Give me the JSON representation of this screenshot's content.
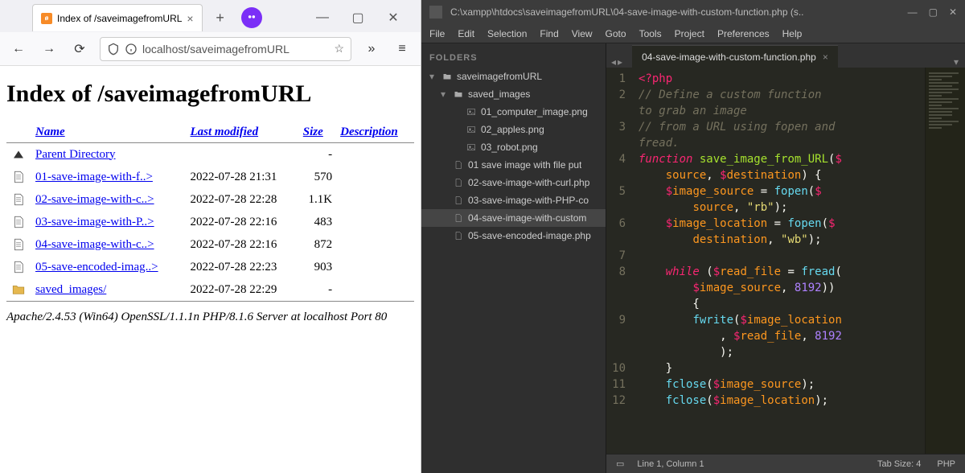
{
  "browser": {
    "tab_title": "Index of /saveimagefromURL",
    "url": "localhost/saveimagefromURL",
    "window_buttons": {
      "min": "—",
      "max": "▢",
      "close": "✕"
    }
  },
  "dirindex": {
    "heading": "Index of /saveimagefromURL",
    "columns": {
      "name": "Name",
      "modified": "Last modified",
      "size": "Size",
      "desc": "Description"
    },
    "parent": "Parent Directory",
    "rows": [
      {
        "name": "01-save-image-with-f..>",
        "modified": "2022-07-28 21:31",
        "size": "570"
      },
      {
        "name": "02-save-image-with-c..>",
        "modified": "2022-07-28 22:28",
        "size": "1.1K"
      },
      {
        "name": "03-save-image-with-P..>",
        "modified": "2022-07-28 22:16",
        "size": "483"
      },
      {
        "name": "04-save-image-with-c..>",
        "modified": "2022-07-28 22:16",
        "size": "872"
      },
      {
        "name": "05-save-encoded-imag..>",
        "modified": "2022-07-28 22:23",
        "size": "903"
      },
      {
        "name": "saved_images/",
        "modified": "2022-07-28 22:29",
        "size": "-"
      }
    ],
    "footer": "Apache/2.4.53 (Win64) OpenSSL/1.1.1n PHP/8.1.6 Server at localhost Port 80"
  },
  "sublime": {
    "title": "C:\\xampp\\htdocs\\saveimagefromURL\\04-save-image-with-custom-function.php (s..",
    "menu": [
      "File",
      "Edit",
      "Selection",
      "Find",
      "View",
      "Goto",
      "Tools",
      "Project",
      "Preferences",
      "Help"
    ],
    "sidebar_title": "FOLDERS",
    "tree": {
      "root": "saveimagefromURL",
      "folder": "saved_images",
      "images": [
        "01_computer_image.png",
        "02_apples.png",
        "03_robot.png"
      ],
      "files": [
        "01 save image with file put",
        "02-save-image-with-curl.php",
        "03-save-image-with-PHP-co",
        "04-save-image-with-custom",
        "05-save-encoded-image.php"
      ],
      "selected_index": 3
    },
    "tab": "04-save-image-with-custom-function.php",
    "gutter": [
      "1",
      "2",
      "",
      "3",
      "",
      "4",
      "",
      "5",
      "",
      "6",
      "",
      "7",
      "8",
      "",
      "",
      "9",
      "",
      "",
      "10",
      "11",
      "12",
      ""
    ],
    "code_tokens": [
      [
        {
          "t": "<?php",
          "c": "c-open"
        }
      ],
      [
        {
          "t": "// Define a custom function",
          "c": "c-cmt"
        }
      ],
      [
        {
          "t": "to grab an image",
          "c": "c-cmt"
        }
      ],
      [
        {
          "t": "// from a URL using fopen and",
          "c": "c-cmt"
        }
      ],
      [
        {
          "t": "fread.",
          "c": "c-cmt"
        }
      ],
      [
        {
          "t": "function",
          "c": "c-kw"
        },
        {
          "t": " "
        },
        {
          "t": "save_image_from_URL",
          "c": "c-fn"
        },
        {
          "t": "("
        },
        {
          "t": "$",
          "c": "c-sig"
        }
      ],
      [
        {
          "t": "    "
        },
        {
          "t": "source",
          "c": "c-var"
        },
        {
          "t": ", "
        },
        {
          "t": "$",
          "c": "c-sig"
        },
        {
          "t": "destination",
          "c": "c-var"
        },
        {
          "t": ") {"
        }
      ],
      [
        {
          "t": "    "
        },
        {
          "t": "$",
          "c": "c-sig"
        },
        {
          "t": "image_source",
          "c": "c-var"
        },
        {
          "t": " = "
        },
        {
          "t": "fopen",
          "c": "c-call"
        },
        {
          "t": "("
        },
        {
          "t": "$",
          "c": "c-sig"
        }
      ],
      [
        {
          "t": "        "
        },
        {
          "t": "source",
          "c": "c-var"
        },
        {
          "t": ", "
        },
        {
          "t": "\"rb\"",
          "c": "c-str"
        },
        {
          "t": ");"
        }
      ],
      [
        {
          "t": "    "
        },
        {
          "t": "$",
          "c": "c-sig"
        },
        {
          "t": "image_location",
          "c": "c-var"
        },
        {
          "t": " = "
        },
        {
          "t": "fopen",
          "c": "c-call"
        },
        {
          "t": "("
        },
        {
          "t": "$",
          "c": "c-sig"
        }
      ],
      [
        {
          "t": "        "
        },
        {
          "t": "destination",
          "c": "c-var"
        },
        {
          "t": ", "
        },
        {
          "t": "\"wb\"",
          "c": "c-str"
        },
        {
          "t": ");"
        }
      ],
      [
        {
          "t": ""
        }
      ],
      [
        {
          "t": "    "
        },
        {
          "t": "while",
          "c": "c-kw"
        },
        {
          "t": " ("
        },
        {
          "t": "$",
          "c": "c-sig"
        },
        {
          "t": "read_file",
          "c": "c-var"
        },
        {
          "t": " = "
        },
        {
          "t": "fread",
          "c": "c-call"
        },
        {
          "t": "("
        }
      ],
      [
        {
          "t": "        "
        },
        {
          "t": "$",
          "c": "c-sig"
        },
        {
          "t": "image_source",
          "c": "c-var"
        },
        {
          "t": ", "
        },
        {
          "t": "8192",
          "c": "c-num"
        },
        {
          "t": "))"
        }
      ],
      [
        {
          "t": "        {"
        }
      ],
      [
        {
          "t": "        "
        },
        {
          "t": "fwrite",
          "c": "c-call"
        },
        {
          "t": "("
        },
        {
          "t": "$",
          "c": "c-sig"
        },
        {
          "t": "image_location",
          "c": "c-var"
        }
      ],
      [
        {
          "t": "            , "
        },
        {
          "t": "$",
          "c": "c-sig"
        },
        {
          "t": "read_file",
          "c": "c-var"
        },
        {
          "t": ", "
        },
        {
          "t": "8192",
          "c": "c-num"
        }
      ],
      [
        {
          "t": "            );"
        }
      ],
      [
        {
          "t": "    }"
        }
      ],
      [
        {
          "t": "    "
        },
        {
          "t": "fclose",
          "c": "c-call"
        },
        {
          "t": "("
        },
        {
          "t": "$",
          "c": "c-sig"
        },
        {
          "t": "image_source",
          "c": "c-var"
        },
        {
          "t": ");"
        }
      ],
      [
        {
          "t": "    "
        },
        {
          "t": "fclose",
          "c": "c-call"
        },
        {
          "t": "("
        },
        {
          "t": "$",
          "c": "c-sig"
        },
        {
          "t": "image_location",
          "c": "c-var"
        },
        {
          "t": ");"
        }
      ],
      [
        {
          "t": ""
        }
      ]
    ],
    "status": {
      "left": "Line 1, Column 1",
      "tabsize": "Tab Size: 4",
      "lang": "PHP"
    }
  }
}
